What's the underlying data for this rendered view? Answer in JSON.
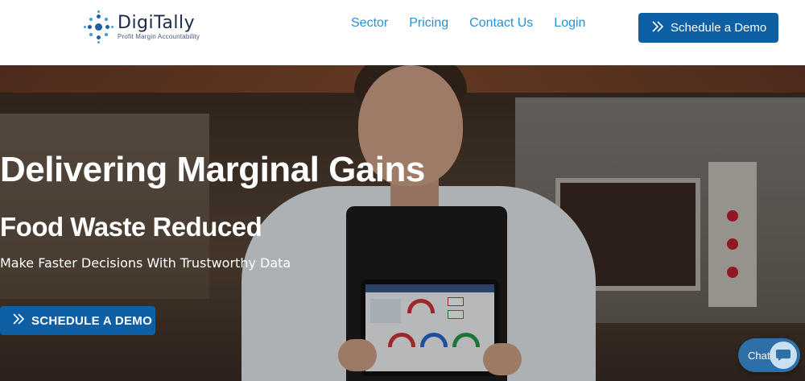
{
  "brand": {
    "name": "DigiTally",
    "tagline": "Profit Margin Accountability",
    "accent": "#0f5fa5",
    "link_color": "#2a8fd0"
  },
  "nav": {
    "items": [
      {
        "label": "Sector"
      },
      {
        "label": "Pricing"
      },
      {
        "label": "Contact Us"
      },
      {
        "label": "Login"
      }
    ]
  },
  "header_cta": {
    "label": "Schedule a Demo",
    "icon": "double-chevron-right-icon"
  },
  "hero": {
    "title": "Delivering Marginal Gains",
    "subtitle": "Food Waste Reduced",
    "tagline": "Make Faster Decisions With Trustworthy Data",
    "cta": {
      "label": "SCHEDULE A DEMO",
      "icon": "double-chevron-right-icon"
    }
  },
  "chat": {
    "label": "Chat",
    "icon": "chat-bubble-icon"
  }
}
